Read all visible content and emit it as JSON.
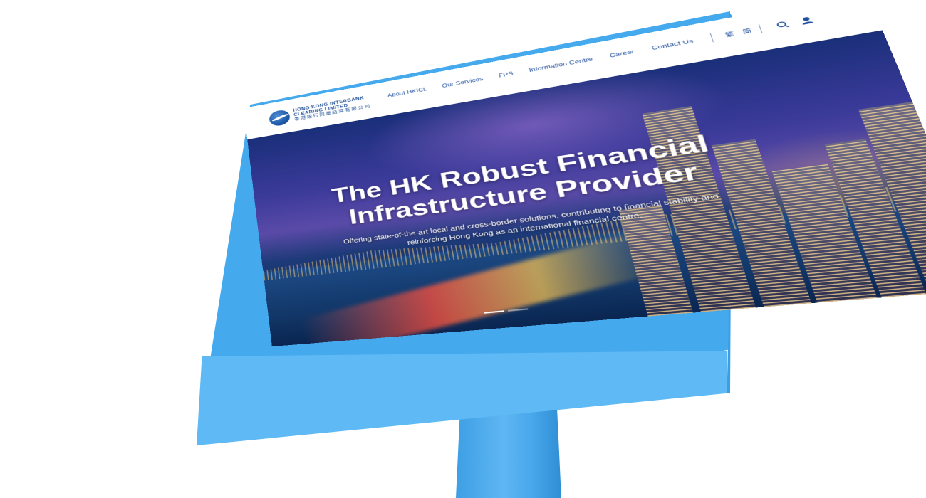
{
  "logo": {
    "name_en_line1": "HONG KONG INTERBANK",
    "name_en_line2": "CLEARING LIMITED",
    "name_zh": "香港銀行同業結算有限公司"
  },
  "nav": {
    "items": [
      "About HKICL",
      "Our Services",
      "FPS",
      "Information Centre",
      "Career",
      "Contact Us"
    ],
    "lang_tc": "繁",
    "lang_sc": "简"
  },
  "hero": {
    "title_line1": "The HK Robust Financial",
    "title_line2": "Infrastructure Provider",
    "subtitle_line1": "Offering state-of-the-art local and cross-border solutions, contributing to financial stability and",
    "subtitle_line2": "reinforcing Hong Kong as an international financial centre.",
    "slides": 2,
    "active_slide": 1
  },
  "colors": {
    "monitor": "#45a9ee",
    "brand_blue": "#1f4f9e"
  },
  "icons": [
    "search-icon",
    "user-icon"
  ]
}
